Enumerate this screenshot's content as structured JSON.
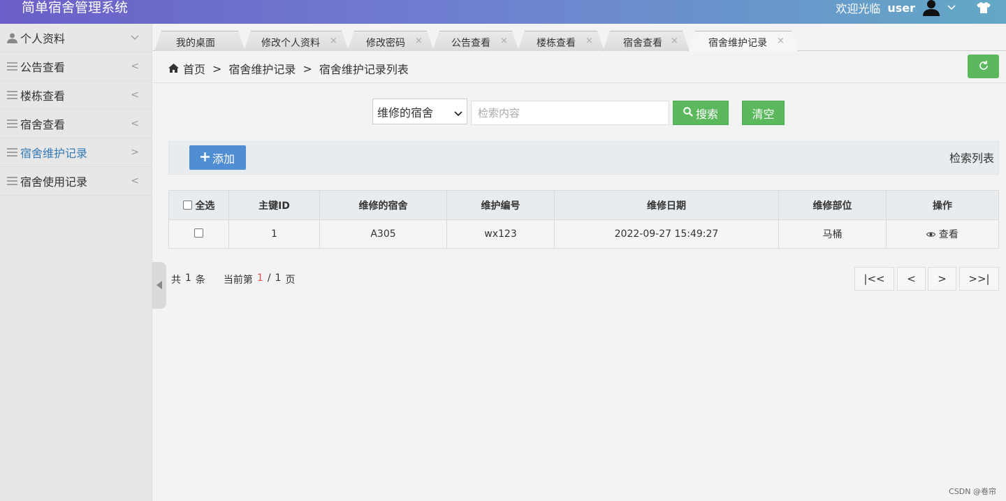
{
  "header": {
    "title": "简单宿舍管理系统",
    "welcome": "欢迎光临",
    "username": "user"
  },
  "sidebar": {
    "items": [
      {
        "label": "个人资料",
        "icon": "user-icon",
        "arrow": "∨"
      },
      {
        "label": "公告查看",
        "icon": "menu-lines-icon",
        "arrow": "<"
      },
      {
        "label": "楼栋查看",
        "icon": "menu-lines-icon",
        "arrow": "<"
      },
      {
        "label": "宿舍查看",
        "icon": "menu-lines-icon",
        "arrow": "<"
      },
      {
        "label": "宿舍维护记录",
        "icon": "menu-lines-icon",
        "arrow": ">"
      },
      {
        "label": "宿舍使用记录",
        "icon": "menu-lines-icon",
        "arrow": "<"
      }
    ]
  },
  "tabs": [
    {
      "label": "我的桌面"
    },
    {
      "label": "修改个人资料",
      "close": "×"
    },
    {
      "label": "修改密码",
      "close": "×"
    },
    {
      "label": "公告查看",
      "close": "×"
    },
    {
      "label": "楼栋查看",
      "close": "×"
    },
    {
      "label": "宿舍查看",
      "close": "×"
    },
    {
      "label": "宿舍维护记录",
      "close": "×"
    }
  ],
  "breadcrumb": {
    "home": "首页",
    "sep": ">",
    "level1": "宿舍维护记录",
    "level2": "宿舍维护记录列表"
  },
  "search": {
    "field_selected": "维修的宿舍",
    "placeholder": "检索内容",
    "search_label": "搜索",
    "clear_label": "清空"
  },
  "toolbar": {
    "add_label": "添加",
    "list_title": "检索列表"
  },
  "table": {
    "select_all": "全选",
    "columns": [
      "主键ID",
      "维修的宿舍",
      "维护编号",
      "维修日期",
      "维修部位",
      "操作"
    ],
    "rows": [
      {
        "id": "1",
        "dorm": "A305",
        "code": "wx123",
        "date": "2022-09-27 15:49:27",
        "part": "马桶",
        "action": "查看"
      }
    ]
  },
  "pagination": {
    "total_prefix": "共",
    "total": "1",
    "total_suffix": "条",
    "current_prefix": "当前第",
    "current": "1",
    "slash": "/",
    "pages": "1",
    "pages_suffix": "页",
    "first": "|<<",
    "prev": "<",
    "next": ">",
    "last": ">>|"
  },
  "watermark": "CSDN @卷帘",
  "colors": {
    "primary_green": "#5cb85c",
    "primary_blue": "#4f8ed2",
    "active_link": "#337ab7",
    "page_current": "#d9534f"
  }
}
